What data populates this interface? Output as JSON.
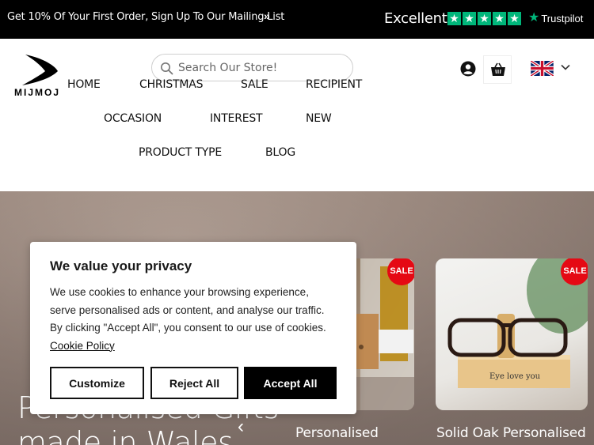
{
  "announcement": {
    "promo_text": "Get 10% Of Your First Order, Sign Up To Our Mailing List",
    "promo_arrow": "»"
  },
  "trustpilot": {
    "rating_text": "Excellent",
    "stars": 5,
    "brand": "Trustpilot",
    "star_color": "#00b67a"
  },
  "header": {
    "logo_text": "MIJMOJ",
    "search_placeholder": "Search Our Store!",
    "account_icon": "user-circle-icon",
    "cart_icon": "basket-icon",
    "language_flag": "uk-flag-icon"
  },
  "nav": {
    "items": [
      "HOME",
      "CHRISTMAS",
      "SALE",
      "RECIPIENT",
      "OCCASION",
      "INTEREST",
      "NEW",
      "PRODUCT TYPE",
      "BLOG"
    ]
  },
  "hero": {
    "title_line1": "Personalised Gifts",
    "title_line2": "made in Wales",
    "prev_arrow": "‹",
    "cards": [
      {
        "badge": "SALE",
        "caption": "Personalised"
      },
      {
        "badge": "SALE",
        "caption": "Solid Oak Personalised",
        "engraving": "Eye love you"
      }
    ]
  },
  "cookie_banner": {
    "title": "We value your privacy",
    "body": "We use cookies to enhance your browsing experience, serve personalised ads or content, and analyse our traffic. By clicking \"Accept All\", you consent to our use of cookies.",
    "link_text": "Cookie Policy",
    "customize_label": "Customize",
    "reject_label": "Reject All",
    "accept_label": "Accept All"
  },
  "colors": {
    "topbar_bg": "#000000",
    "sale_badge": "#e50914"
  }
}
